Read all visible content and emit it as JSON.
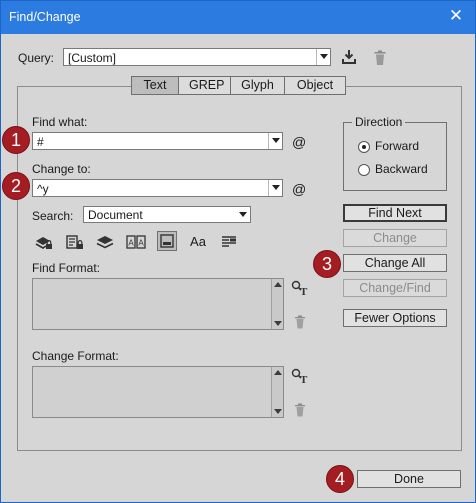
{
  "window": {
    "title": "Find/Change",
    "close_glyph": "✕"
  },
  "query": {
    "label": "Query:",
    "value": "[Custom]",
    "save_icon": "save-query-icon",
    "delete_icon": "delete-query-icon"
  },
  "tabs": [
    {
      "label": "Text",
      "active": true
    },
    {
      "label": "GREP",
      "active": false
    },
    {
      "label": "Glyph",
      "active": false
    },
    {
      "label": "Object",
      "active": false
    }
  ],
  "find_what": {
    "label": "Find what:",
    "value": "#",
    "special_chars_glyph": "@"
  },
  "change_to": {
    "label": "Change to:",
    "value": "^y",
    "special_chars_glyph": "@"
  },
  "search": {
    "label": "Search:",
    "value": "Document"
  },
  "options_icons": [
    {
      "name": "include-locked-layers-icon",
      "selected": false
    },
    {
      "name": "include-locked-stories-icon",
      "selected": false
    },
    {
      "name": "include-hidden-layers-icon",
      "selected": false
    },
    {
      "name": "include-master-pages-icon",
      "selected": false
    },
    {
      "name": "include-footnotes-icon",
      "selected": true
    },
    {
      "name": "case-sensitive-icon",
      "selected": false,
      "text": "Aa"
    },
    {
      "name": "whole-word-icon",
      "selected": false
    }
  ],
  "find_format": {
    "label": "Find Format:"
  },
  "change_format": {
    "label": "Change Format:"
  },
  "direction": {
    "title": "Direction",
    "forward": "Forward",
    "backward": "Backward",
    "selected": "Forward"
  },
  "buttons": {
    "find_next": "Find Next",
    "change": "Change",
    "change_all": "Change All",
    "change_find": "Change/Find",
    "fewer_options": "Fewer Options",
    "done": "Done"
  },
  "badges": [
    "1",
    "2",
    "3",
    "4"
  ],
  "colors": {
    "titlebar": "#2c7be0",
    "dialog_bg": "#d6d6d6",
    "badge": "#a31d22"
  }
}
